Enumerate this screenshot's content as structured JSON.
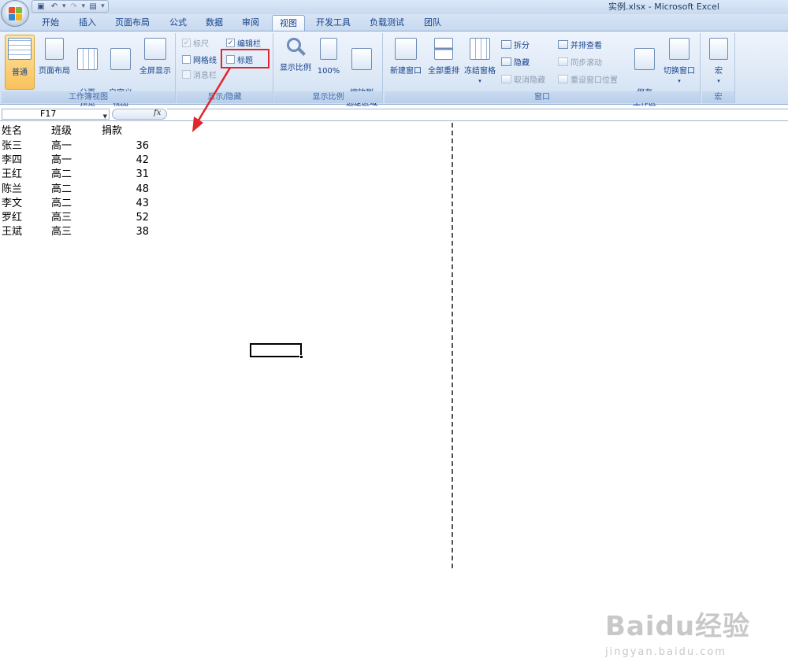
{
  "window": {
    "title": "实例.xlsx - Microsoft Excel"
  },
  "qat": {
    "icons": [
      "save-icon",
      "undo-icon",
      "redo-icon",
      "customize-icon"
    ]
  },
  "tabs": [
    {
      "label": "开始"
    },
    {
      "label": "插入"
    },
    {
      "label": "页面布局"
    },
    {
      "label": "公式"
    },
    {
      "label": "数据"
    },
    {
      "label": "审阅"
    },
    {
      "label": "视图",
      "active": true
    },
    {
      "label": "开发工具"
    },
    {
      "label": "负载测试"
    },
    {
      "label": "团队"
    }
  ],
  "ribbon": {
    "workbook_views": {
      "label": "工作簿视图",
      "normal": "普通",
      "page_layout": "页面布局",
      "page_break": "分页\n预览",
      "custom": "自定义\n视图",
      "fullscreen": "全屏显示"
    },
    "show_hide": {
      "label": "显示/隐藏",
      "ruler": "标尺",
      "formula_bar": "编辑栏",
      "gridlines": "网格线",
      "headings": "标题",
      "message_bar": "消息栏",
      "formula_bar_checked": true,
      "headings_checked": false
    },
    "zoom": {
      "label": "显示比例",
      "zoom": "显示比例",
      "hundred": "100%",
      "zoom_to_selection": "缩放到\n选定区域"
    },
    "window": {
      "label": "窗口",
      "new_window": "新建窗口",
      "arrange_all": "全部重排",
      "freeze_panes": "冻结窗格",
      "split": "拆分",
      "hide": "隐藏",
      "unhide": "取消隐藏",
      "side_by_side": "并排查看",
      "sync_scroll": "同步滚动",
      "reset_position": "重设窗口位置",
      "save_workspace": "保存\n工作区",
      "switch_windows": "切换窗口"
    },
    "macros": {
      "label": "宏",
      "macros": "宏"
    }
  },
  "formula_bar": {
    "name_box": "F17",
    "fx": "fx",
    "value": ""
  },
  "sheet": {
    "headers": [
      "姓名",
      "班级",
      "捐款"
    ],
    "rows": [
      {
        "name": "张三",
        "class": "高一",
        "amount": "36"
      },
      {
        "name": "李四",
        "class": "高一",
        "amount": "42"
      },
      {
        "name": "王红",
        "class": "高二",
        "amount": "31"
      },
      {
        "name": "陈兰",
        "class": "高二",
        "amount": "48"
      },
      {
        "name": "李文",
        "class": "高二",
        "amount": "43"
      },
      {
        "name": "罗红",
        "class": "高三",
        "amount": "52"
      },
      {
        "name": "王斌",
        "class": "高三",
        "amount": "38"
      }
    ]
  },
  "watermark": {
    "brand": "Baidu经验",
    "url": "jingyan.baidu.com"
  },
  "colors": {
    "highlight": "#e0262a",
    "ribbon_text": "#15428b"
  }
}
